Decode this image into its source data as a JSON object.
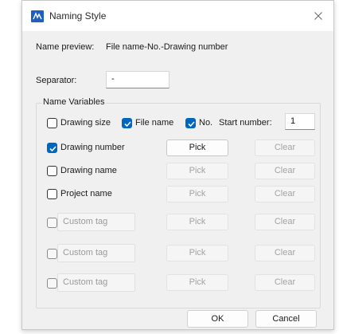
{
  "window": {
    "title": "Naming Style",
    "close_icon": "close-icon",
    "app_icon": "app-logo-icon"
  },
  "preview": {
    "label": "Name preview:",
    "value": "File name-No.-Drawing number"
  },
  "separator": {
    "label": "Separator:",
    "value": "-"
  },
  "group": {
    "title": "Name Variables"
  },
  "row1": {
    "drawing_size": {
      "label": "Drawing size",
      "checked": false
    },
    "file_name": {
      "label": "File name",
      "checked": true
    },
    "no": {
      "label": "No.",
      "checked": true
    },
    "start_number_label": "Start number:",
    "start_number_value": "1"
  },
  "variables": [
    {
      "label": "Drawing number",
      "checked": true,
      "enabled": true,
      "pick": "Pick",
      "clear": "Clear"
    },
    {
      "label": "Drawing name",
      "checked": false,
      "enabled": true,
      "pick": "Pick",
      "clear": "Clear"
    },
    {
      "label": "Project name",
      "checked": false,
      "enabled": true,
      "pick": "Pick",
      "clear": "Clear"
    }
  ],
  "custom_tags": [
    {
      "label": "Custom tag",
      "pick": "Pick",
      "clear": "Clear"
    },
    {
      "label": "Custom tag",
      "pick": "Pick",
      "clear": "Clear"
    },
    {
      "label": "Custom tag",
      "pick": "Pick",
      "clear": "Clear"
    }
  ],
  "footer": {
    "ok": "OK",
    "cancel": "Cancel"
  },
  "colors": {
    "accent": "#0067c0",
    "dialog_bg": "#f0f0f0"
  }
}
